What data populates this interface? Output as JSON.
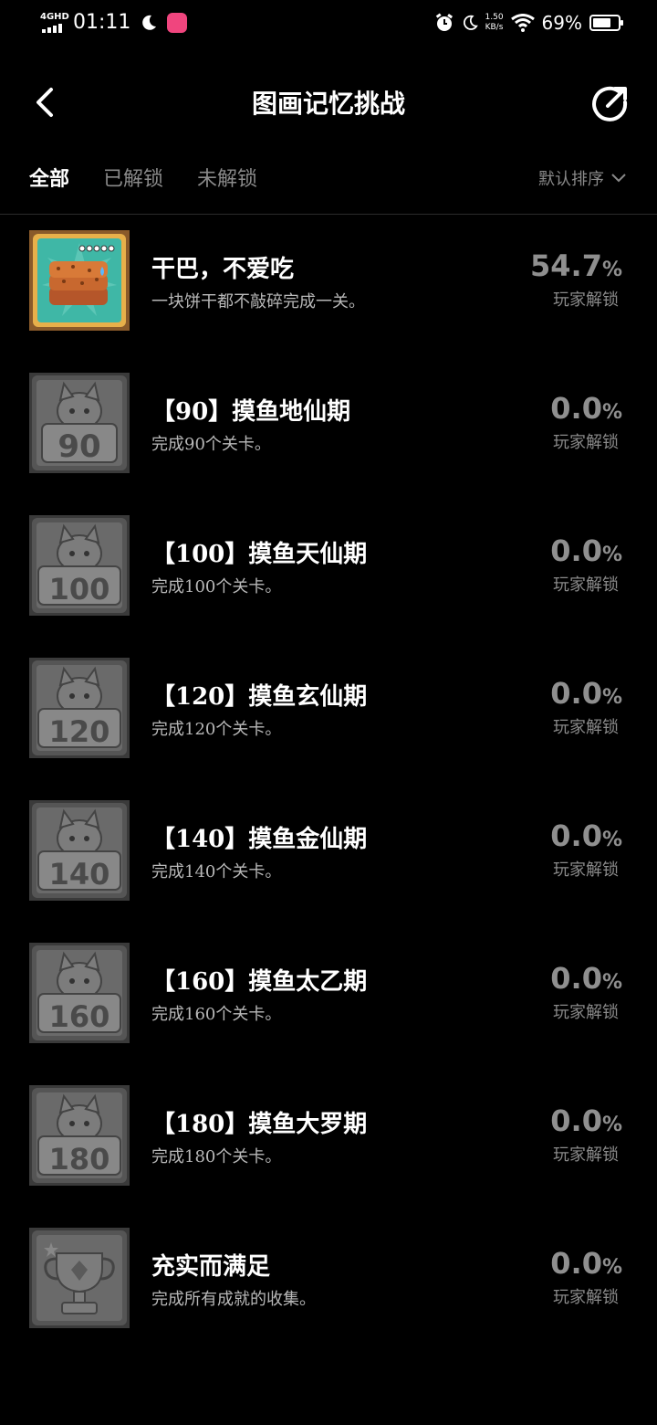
{
  "status_bar": {
    "network": "4GHD",
    "time": "01:11",
    "speed_value": "1.50",
    "speed_unit": "KB/s",
    "battery_percent": "69%"
  },
  "header": {
    "title": "图画记忆挑战",
    "back_icon": "chevron-left-icon",
    "share_icon": "share-icon"
  },
  "tabs": [
    {
      "label": "全部",
      "active": true
    },
    {
      "label": "已解锁",
      "active": false
    },
    {
      "label": "未解锁",
      "active": false
    }
  ],
  "sort": {
    "label": "默认排序"
  },
  "achievements": [
    {
      "title": "干巴，不爱吃",
      "desc": "一块饼干都不敲碎完成一关。",
      "percent": "54.7",
      "percent_sign": "%",
      "percent_label": "玩家解锁",
      "unlocked": true,
      "badge_text": ""
    },
    {
      "title": "【90】摸鱼地仙期",
      "desc": "完成90个关卡。",
      "percent": "0.0",
      "percent_sign": "%",
      "percent_label": "玩家解锁",
      "unlocked": false,
      "badge_text": "90"
    },
    {
      "title": "【100】摸鱼天仙期",
      "desc": "完成100个关卡。",
      "percent": "0.0",
      "percent_sign": "%",
      "percent_label": "玩家解锁",
      "unlocked": false,
      "badge_text": "100"
    },
    {
      "title": "【120】摸鱼玄仙期",
      "desc": "完成120个关卡。",
      "percent": "0.0",
      "percent_sign": "%",
      "percent_label": "玩家解锁",
      "unlocked": false,
      "badge_text": "120"
    },
    {
      "title": "【140】摸鱼金仙期",
      "desc": "完成140个关卡。",
      "percent": "0.0",
      "percent_sign": "%",
      "percent_label": "玩家解锁",
      "unlocked": false,
      "badge_text": "140"
    },
    {
      "title": "【160】摸鱼太乙期",
      "desc": "完成160个关卡。",
      "percent": "0.0",
      "percent_sign": "%",
      "percent_label": "玩家解锁",
      "unlocked": false,
      "badge_text": "160"
    },
    {
      "title": "【180】摸鱼大罗期",
      "desc": "完成180个关卡。",
      "percent": "0.0",
      "percent_sign": "%",
      "percent_label": "玩家解锁",
      "unlocked": false,
      "badge_text": "180"
    },
    {
      "title": "充实而满足",
      "desc": "完成所有成就的收集。",
      "percent": "0.0",
      "percent_sign": "%",
      "percent_label": "玩家解锁",
      "unlocked": false,
      "badge_text": ""
    }
  ],
  "colors": {
    "background": "#000000",
    "text_primary": "#ffffff",
    "text_secondary": "#b8b8b8",
    "text_muted": "#8a8a8a",
    "badge_locked": "#5a5a5a",
    "badge_unlocked_frame": "#e8b04a",
    "badge_unlocked_bg": "#3fb7a6"
  }
}
